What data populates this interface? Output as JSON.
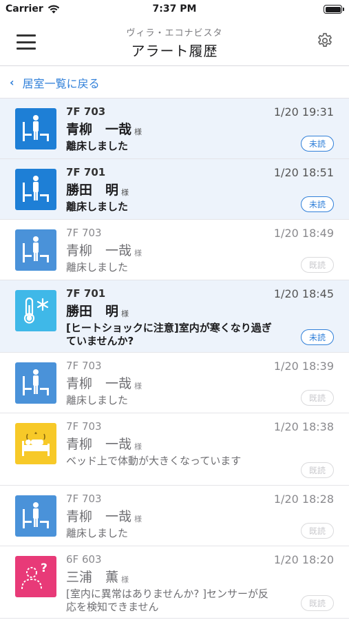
{
  "status_bar": {
    "carrier": "Carrier",
    "time": "7:37 PM"
  },
  "nav": {
    "subtitle": "ヴィラ・エコナビスタ",
    "title": "アラート履歴"
  },
  "back": {
    "label": "居室一覧に戻る"
  },
  "honorific": "様",
  "colors": {
    "accent": "#2f7fd9",
    "unread_bg": "#edf3fb",
    "bed_icon": "#1e7fd6",
    "bed_icon_read": "#4a92d9",
    "heat_icon": "#3fb8e8",
    "motion_icon": "#f7c928",
    "anomaly_icon": "#e83a78"
  },
  "alerts": [
    {
      "room": "7F 703",
      "name": "青柳　一哉",
      "message": "離床しました",
      "time": "1/20 19:31",
      "status": "未読",
      "unread": true,
      "icon": "bed-exit-icon"
    },
    {
      "room": "7F 701",
      "name": "勝田　明",
      "message": "離床しました",
      "time": "1/20 18:51",
      "status": "未読",
      "unread": true,
      "icon": "bed-exit-icon"
    },
    {
      "room": "7F 703",
      "name": "青柳　一哉",
      "message": "離床しました",
      "time": "1/20 18:49",
      "status": "既読",
      "unread": false,
      "icon": "bed-exit-icon"
    },
    {
      "room": "7F 701",
      "name": "勝田　明",
      "message": "[ヒートショックに注意]室内が寒くなり過ぎていませんか?",
      "time": "1/20 18:45",
      "status": "未読",
      "unread": true,
      "icon": "thermometer-cold-icon"
    },
    {
      "room": "7F 703",
      "name": "青柳　一哉",
      "message": "離床しました",
      "time": "1/20 18:39",
      "status": "既読",
      "unread": false,
      "icon": "bed-exit-icon"
    },
    {
      "room": "7F 703",
      "name": "青柳　一哉",
      "message": "ベッド上で体動が大きくなっています",
      "time": "1/20 18:38",
      "status": "既読",
      "unread": false,
      "icon": "bed-motion-icon"
    },
    {
      "room": "7F 703",
      "name": "青柳　一哉",
      "message": "離床しました",
      "time": "1/20 18:28",
      "status": "既読",
      "unread": false,
      "icon": "bed-exit-icon"
    },
    {
      "room": "6F 603",
      "name": "三浦　薫",
      "message": "[室内に異常はありませんか? ]センサーが反応を検知できません",
      "time": "1/20 18:20",
      "status": "既読",
      "unread": false,
      "icon": "person-question-icon"
    }
  ]
}
